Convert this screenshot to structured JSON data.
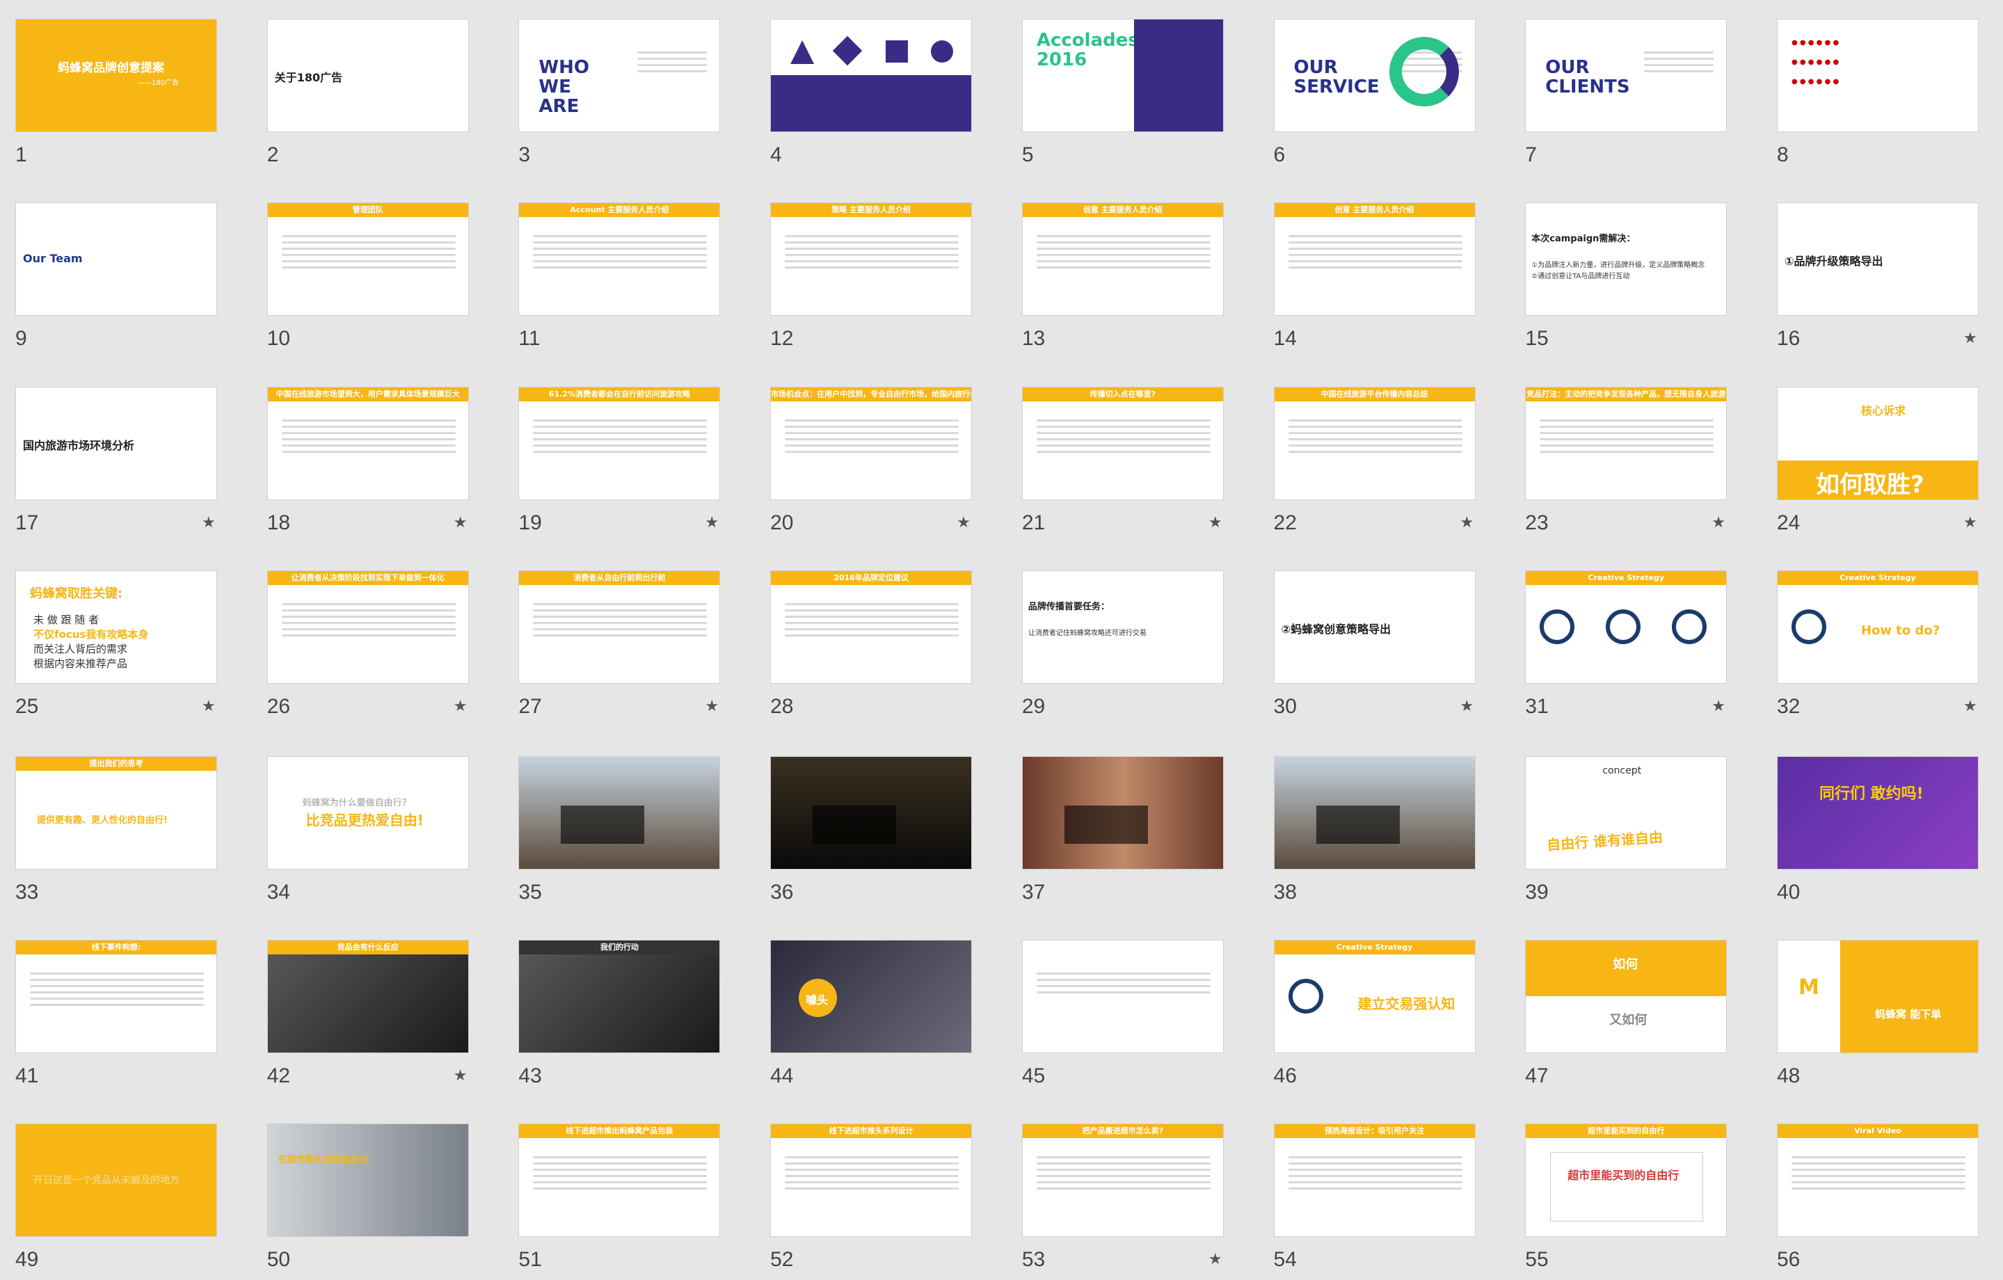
{
  "slides": [
    {
      "n": "1",
      "star": false,
      "title": "蚂蜂窝品牌创意提案",
      "sub": "——180广告"
    },
    {
      "n": "2",
      "star": false,
      "title": "关于180广告"
    },
    {
      "n": "3",
      "star": false,
      "title": "WHO WE ARE"
    },
    {
      "n": "4",
      "star": false
    },
    {
      "n": "5",
      "star": false,
      "title": "Accolades 2016"
    },
    {
      "n": "6",
      "star": false,
      "title": "OUR SERVICE"
    },
    {
      "n": "7",
      "star": false,
      "title": "OUR CLIENTS"
    },
    {
      "n": "8",
      "star": false
    },
    {
      "n": "9",
      "star": false,
      "title": "Our Team"
    },
    {
      "n": "10",
      "star": false,
      "title": "管理团队"
    },
    {
      "n": "11",
      "star": false,
      "title": "Account 主要服务人员介绍"
    },
    {
      "n": "12",
      "star": false,
      "title": "策略 主要服务人员介绍"
    },
    {
      "n": "13",
      "star": false,
      "title": "创意 主要服务人员介绍"
    },
    {
      "n": "14",
      "star": false,
      "title": "创意 主要服务人员介绍"
    },
    {
      "n": "15",
      "star": false,
      "title": "本次campaign需解决：",
      "l1": "①为品牌注入新力量，进行品牌升级，定义品牌策略概念",
      "l2": "②通过创意让TA与品牌进行互动"
    },
    {
      "n": "16",
      "star": true,
      "title": "①品牌升级策略导出"
    },
    {
      "n": "17",
      "star": true,
      "title": "国内旅游市场环境分析"
    },
    {
      "n": "18",
      "star": true,
      "title": "中国在线旅游市场望到大，用户需求具体场景规模巨大"
    },
    {
      "n": "19",
      "star": true,
      "title": "61.2%消费者都会在自行前访问旅游攻略"
    },
    {
      "n": "20",
      "star": true,
      "title": "市场机会点：在用户中找到，专业自由行市场，给国内旅行者服务"
    },
    {
      "n": "21",
      "star": true,
      "title": "传播切入点在哪里?"
    },
    {
      "n": "22",
      "star": true,
      "title": "中国在线旅游平台传播内容总结"
    },
    {
      "n": "23",
      "star": true,
      "title": "竞品打法：主动的把竞争发现各种产品，提无限自身人旅游"
    },
    {
      "n": "24",
      "star": true,
      "title": "核心诉求",
      "big": "如何取胜?"
    },
    {
      "n": "25",
      "star": true,
      "title": "蚂蜂窝取胜关键:",
      "l1": "未 做 跟 随 者",
      "l2": "不仅focus我有攻略本身",
      "l3": "而关注人背后的需求",
      "l4": "根据内容来推荐产品"
    },
    {
      "n": "26",
      "star": true,
      "title": "让消费者从决策阶段找到实现下单做到一体化"
    },
    {
      "n": "27",
      "star": true,
      "title": "消费者从自由行前到出行前"
    },
    {
      "n": "28",
      "star": false,
      "title": "2016年品牌定位建议"
    },
    {
      "n": "29",
      "star": false,
      "title": "品牌传播首要任务：",
      "l1": "让消费者记住蚂蜂窝攻略还可进行交易"
    },
    {
      "n": "30",
      "star": true,
      "title": "②蚂蜂窝创意策略导出"
    },
    {
      "n": "31",
      "star": true,
      "title": "Creative Strategy"
    },
    {
      "n": "32",
      "star": true,
      "title": "Creative Strategy",
      "l1": "How to do?"
    },
    {
      "n": "33",
      "star": false,
      "title": "提出我们的思考",
      "l1": "提供更有趣、更人性化的自由行!"
    },
    {
      "n": "34",
      "star": false,
      "title": "蚂蜂窝为什么要做自由行?",
      "l1": "比竞品更热爱自由!"
    },
    {
      "n": "35",
      "star": false
    },
    {
      "n": "36",
      "star": false
    },
    {
      "n": "37",
      "star": false
    },
    {
      "n": "38",
      "star": false
    },
    {
      "n": "39",
      "star": false,
      "title": "concept",
      "l1": "自由行 谁有谁自由"
    },
    {
      "n": "40",
      "star": false,
      "title": "同行们 敢约吗!"
    },
    {
      "n": "41",
      "star": false,
      "title": "线下事件构想:"
    },
    {
      "n": "42",
      "star": true,
      "title": "竞品会有什么反应"
    },
    {
      "n": "43",
      "star": false,
      "title": "我们的行动"
    },
    {
      "n": "44",
      "star": false,
      "title": "噱头"
    },
    {
      "n": "45",
      "star": false
    },
    {
      "n": "46",
      "star": false,
      "title": "Creative Strategy",
      "l1": "建立交易强认知"
    },
    {
      "n": "47",
      "star": false,
      "title": "如何",
      "l1": "又如何"
    },
    {
      "n": "48",
      "star": false,
      "title": "蚂蜂窝 能下单"
    },
    {
      "n": "49",
      "star": false,
      "title": "开日这是一个竞品从未触及的地方"
    },
    {
      "n": "50",
      "star": false,
      "title": "在超市能买到的自由行"
    },
    {
      "n": "51",
      "star": false,
      "title": "线下进超市推出蚂蜂窝产品包装"
    },
    {
      "n": "52",
      "star": false,
      "title": "线下进超市推头系列设计"
    },
    {
      "n": "53",
      "star": true,
      "title": "把产品搬进超市怎么卖?"
    },
    {
      "n": "54",
      "star": false,
      "title": "预热海报设计：吸引用户关注"
    },
    {
      "n": "55",
      "star": false,
      "title": "超市里能买到的自由行"
    },
    {
      "n": "56",
      "star": false,
      "title": "Viral Video"
    }
  ]
}
